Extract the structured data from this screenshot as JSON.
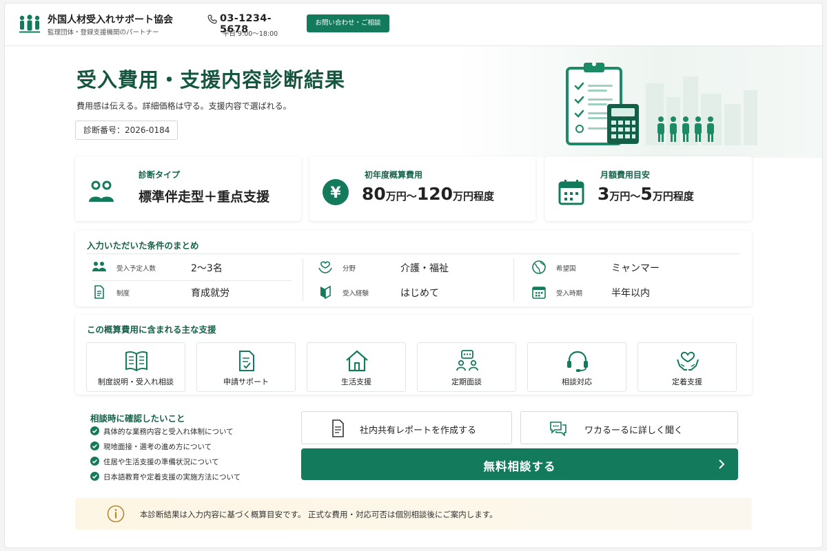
{
  "header": {
    "org_name": "外国人材受入れサポート協会",
    "org_sub": "監理団体・登録支援機関のパートナー",
    "phone": "03-1234-5678",
    "hours": "平日 9:00〜18:00",
    "contact_label": "お問い合わせ・ご相談"
  },
  "hero": {
    "title": "受入費用・支援内容診断結果",
    "subtitle": "費用感は伝える。詳細価格は守る。支援内容で選ばれる。",
    "diagnosis_no": "診断番号：2026-0184"
  },
  "summary": {
    "type_label": "診断タイプ",
    "type_value": "標準伴走型＋重点支援",
    "first_year_label": "初年度概算費用",
    "first_year_min": "80",
    "first_year_unit1": "万円〜",
    "first_year_max": "120",
    "first_year_unit2": "万円程度",
    "monthly_label": "月額費用目安",
    "monthly_min": "3",
    "monthly_unit1": "万円〜",
    "monthly_max": "5",
    "monthly_unit2": "万円程度"
  },
  "conditions": {
    "title": "入力いただいた条件のまとめ",
    "items": [
      {
        "label": "受入予定人数",
        "value": "2〜3名",
        "icon": "people-icon"
      },
      {
        "label": "分野",
        "value": "介護・福祉",
        "icon": "care-hands-icon"
      },
      {
        "label": "希望国",
        "value": "ミャンマー",
        "icon": "globe-icon"
      },
      {
        "label": "制度",
        "value": "育成就労",
        "icon": "document-icon"
      },
      {
        "label": "受入経験",
        "value": "はじめて",
        "icon": "beginner-mark-icon"
      },
      {
        "label": "受入時期",
        "value": "半年以内",
        "icon": "calendar-icon"
      }
    ]
  },
  "support": {
    "title": "この概算費用に含まれる主な支援",
    "tiles": [
      {
        "label": "制度説明・受入れ相談",
        "icon": "book-icon"
      },
      {
        "label": "申請サポート",
        "icon": "application-form-icon"
      },
      {
        "label": "生活支援",
        "icon": "house-icon"
      },
      {
        "label": "定期面談",
        "icon": "meeting-icon"
      },
      {
        "label": "相談対応",
        "icon": "headset-icon"
      },
      {
        "label": "定着支援",
        "icon": "heart-hands-icon"
      }
    ]
  },
  "checklist": {
    "title": "相談時に確認したいこと",
    "items": [
      "具体的な業務内容と受入れ体制について",
      "現地面接・選考の進め方について",
      "住居や生活支援の準備状況について",
      "日本語教育や定着支援の実施方法について"
    ]
  },
  "actions": {
    "report_label": "社内共有レポートを作成する",
    "ask_label": "ワカるーるに詳しく聞く",
    "consult_label": "無料相談する"
  },
  "notice": {
    "text": "本診断結果は入力内容に基づく概算目安です。 正式な費用・対応可否は個別相談後にご案内します。"
  },
  "colors": {
    "brand_green": "#137a5b",
    "dark_green": "#14563f",
    "notice_bg": "#fdf6e4"
  }
}
